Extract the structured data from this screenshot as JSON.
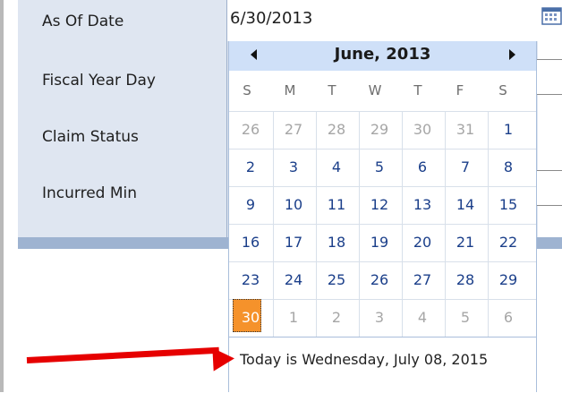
{
  "form": {
    "labels": {
      "as_of_date": "As Of Date",
      "fiscal_year_day": "Fiscal Year Day",
      "claim_status": "Claim Status",
      "incurred_min": "Incurred Min"
    },
    "as_of_date_value": "6/30/2013"
  },
  "calendar": {
    "title": "June, 2013",
    "day_names": [
      "S",
      "M",
      "T",
      "W",
      "T",
      "F",
      "S"
    ],
    "weeks": [
      [
        {
          "d": "26",
          "o": true
        },
        {
          "d": "27",
          "o": true
        },
        {
          "d": "28",
          "o": true
        },
        {
          "d": "29",
          "o": true
        },
        {
          "d": "30",
          "o": true
        },
        {
          "d": "31",
          "o": true
        },
        {
          "d": "1",
          "o": false
        }
      ],
      [
        {
          "d": "2",
          "o": false
        },
        {
          "d": "3",
          "o": false
        },
        {
          "d": "4",
          "o": false
        },
        {
          "d": "5",
          "o": false
        },
        {
          "d": "6",
          "o": false
        },
        {
          "d": "7",
          "o": false
        },
        {
          "d": "8",
          "o": false
        }
      ],
      [
        {
          "d": "9",
          "o": false
        },
        {
          "d": "10",
          "o": false
        },
        {
          "d": "11",
          "o": false
        },
        {
          "d": "12",
          "o": false
        },
        {
          "d": "13",
          "o": false
        },
        {
          "d": "14",
          "o": false
        },
        {
          "d": "15",
          "o": false
        }
      ],
      [
        {
          "d": "16",
          "o": false
        },
        {
          "d": "17",
          "o": false
        },
        {
          "d": "18",
          "o": false
        },
        {
          "d": "19",
          "o": false
        },
        {
          "d": "20",
          "o": false
        },
        {
          "d": "21",
          "o": false
        },
        {
          "d": "22",
          "o": false
        }
      ],
      [
        {
          "d": "23",
          "o": false
        },
        {
          "d": "24",
          "o": false
        },
        {
          "d": "25",
          "o": false
        },
        {
          "d": "26",
          "o": false
        },
        {
          "d": "27",
          "o": false
        },
        {
          "d": "28",
          "o": false
        },
        {
          "d": "29",
          "o": false
        }
      ],
      [
        {
          "d": "30",
          "o": false,
          "sel": true
        },
        {
          "d": "1",
          "o": true
        },
        {
          "d": "2",
          "o": true
        },
        {
          "d": "3",
          "o": true
        },
        {
          "d": "4",
          "o": true
        },
        {
          "d": "5",
          "o": true
        },
        {
          "d": "6",
          "o": true
        }
      ]
    ],
    "today_text": "Today is Wednesday, July 08, 2015",
    "colors": {
      "header_bg": "#cfe0f8",
      "current_month_day": "#1b3f8a",
      "other_month_day": "#a6a6a6",
      "selected_bg": "#f5922b",
      "annotation_arrow": "#e60000"
    }
  },
  "icons": {
    "calendar_button": "calendar-icon",
    "prev_month": "triangle-left-icon",
    "next_month": "triangle-right-icon",
    "annotation": "red-arrow-icon"
  }
}
